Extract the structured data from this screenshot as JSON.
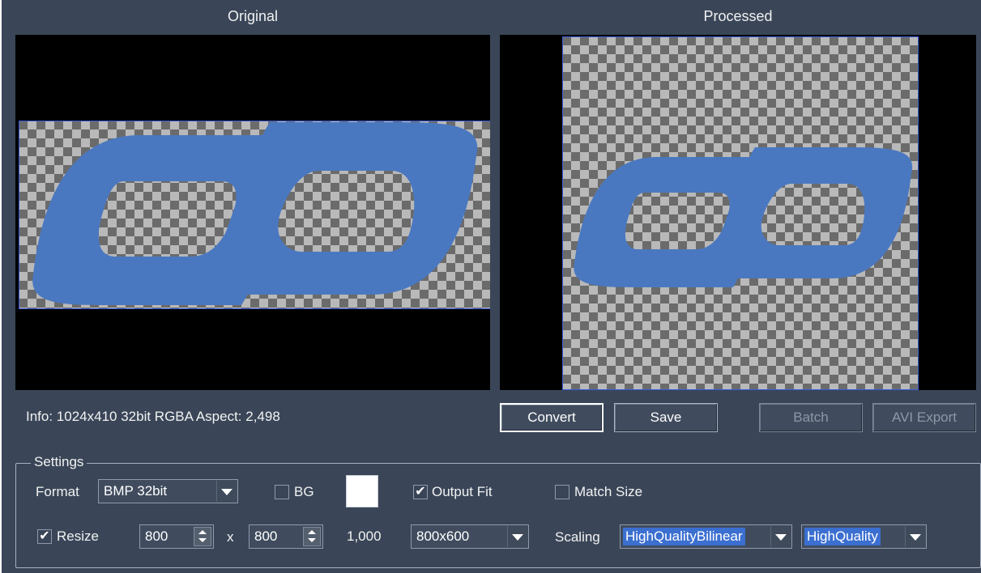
{
  "captions": {
    "original": "Original",
    "processed": "Processed"
  },
  "info": "Info:  1024x410 32bit RGBA Aspect: 2,498",
  "buttons": {
    "convert": "Convert",
    "save": "Save",
    "batch": "Batch",
    "avi_export": "AVI Export"
  },
  "settings": {
    "title": "Settings",
    "format_label": "Format",
    "format_value": "BMP 32bit",
    "bg_label": "BG",
    "bg_checked": false,
    "bg_color": "#ffffff",
    "output_fit_label": "Output Fit",
    "output_fit_checked": true,
    "match_size_label": "Match Size",
    "match_size_checked": false,
    "resize_label": "Resize",
    "resize_checked": true,
    "width_value": "800",
    "times_label": "x",
    "height_value": "800",
    "ratio": "1,000",
    "preset_value": "800x600",
    "scaling_label": "Scaling",
    "scaling_value": "HighQualityBilinear",
    "quality_value": "HighQuality"
  },
  "colors": {
    "background": "#3a4658",
    "logo": "#4a78c0",
    "selection": "#3b6fd0",
    "image_frame": "#3a5bd8"
  }
}
